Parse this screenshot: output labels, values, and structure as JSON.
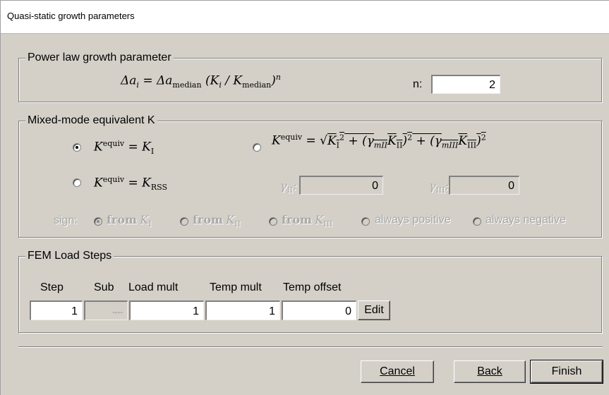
{
  "window": {
    "title": "Quasi-static growth parameters"
  },
  "power_law": {
    "legend": "Power law growth parameter",
    "n_label": "n:",
    "n_value": "2"
  },
  "mixed_mode": {
    "legend": "Mixed-mode equivalent K",
    "option_ki_selected": true,
    "option_sqrt_selected": false,
    "option_rss_selected": false,
    "gamma_ii_value": "0",
    "gamma_iii_value": "0",
    "sign_label": "sign:",
    "sign_options": {
      "from": "from",
      "always_positive": "always positive",
      "always_negative": "always negative"
    }
  },
  "fem": {
    "legend": "FEM Load Steps",
    "columns": [
      "Step",
      "Sub",
      "Load mult",
      "Temp mult",
      "Temp offset"
    ],
    "row": {
      "step": "1",
      "sub": "----",
      "load_mult": "1",
      "temp_mult": "1",
      "temp_offset": "0"
    },
    "edit_label": "Edit"
  },
  "buttons": {
    "cancel": "Cancel",
    "back": "Back",
    "finish": "Finish"
  }
}
